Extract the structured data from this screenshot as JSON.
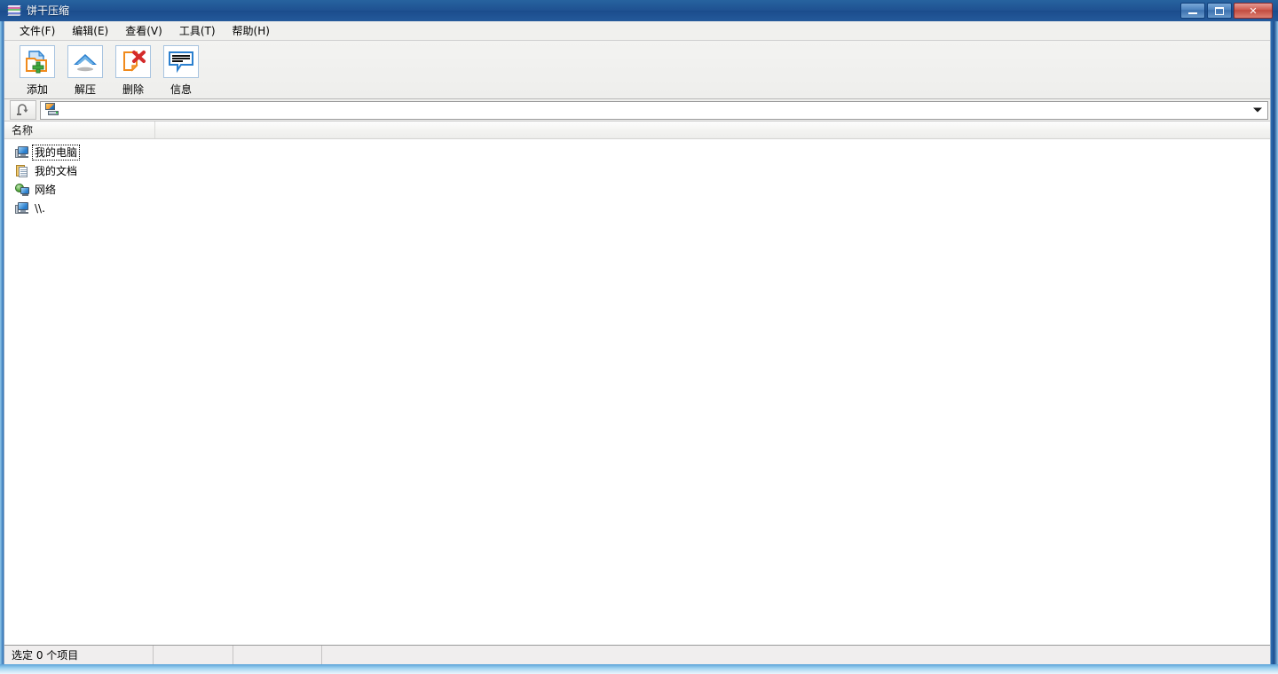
{
  "window": {
    "title": "饼干压缩",
    "title_icon": "archive-icon",
    "controls": {
      "minimize_name": "minimize-button",
      "maximize_name": "restore-button",
      "close_name": "close-button",
      "close_glyph": "✕"
    }
  },
  "menubar": {
    "items": [
      {
        "label": "文件(F)",
        "name": "menu-file"
      },
      {
        "label": "编辑(E)",
        "name": "menu-edit"
      },
      {
        "label": "查看(V)",
        "name": "menu-view"
      },
      {
        "label": "工具(T)",
        "name": "menu-tools"
      },
      {
        "label": "帮助(H)",
        "name": "menu-help"
      }
    ]
  },
  "toolbar": {
    "buttons": [
      {
        "label": "添加",
        "icon": "add-archive-icon"
      },
      {
        "label": "解压",
        "icon": "extract-up-arrow-icon"
      },
      {
        "label": "删除",
        "icon": "delete-document-icon"
      },
      {
        "label": "信息",
        "icon": "info-speech-bubble-icon"
      }
    ]
  },
  "addressbar": {
    "up_button_icon": "up-one-level-icon",
    "path_icon": "my-computer-icon",
    "path_value": "",
    "path_placeholder": "",
    "dropdown_icon": "chevron-down-icon"
  },
  "filelist": {
    "columns": [
      {
        "label": "名称",
        "name": "column-header-name"
      },
      {
        "label": "",
        "name": "column-header-blank"
      }
    ],
    "rows": [
      {
        "name": "我的电脑",
        "icon": "computer-icon",
        "focused": true
      },
      {
        "name": "我的文档",
        "icon": "documents-icon",
        "focused": false
      },
      {
        "name": "网络",
        "icon": "network-icon",
        "focused": false
      },
      {
        "name": "\\\\.",
        "icon": "computer-icon",
        "focused": false
      }
    ]
  },
  "statusbar": {
    "cells": [
      {
        "text": "选定 0 个项目",
        "name": "status-selection-count"
      },
      {
        "text": "",
        "name": "status-cell-2"
      },
      {
        "text": "",
        "name": "status-cell-3"
      },
      {
        "text": "",
        "name": "status-cell-4"
      }
    ]
  },
  "colors": {
    "titlebar_blue": "#1f5499",
    "close_red": "#c04a3e",
    "chrome_grey": "#f0f0ee",
    "list_white": "#ffffff",
    "accent_icon_orange": "#f08a1c",
    "accent_icon_blue": "#2a7fcf",
    "accent_icon_green": "#3faa3f",
    "accent_icon_red": "#d42b2b"
  }
}
